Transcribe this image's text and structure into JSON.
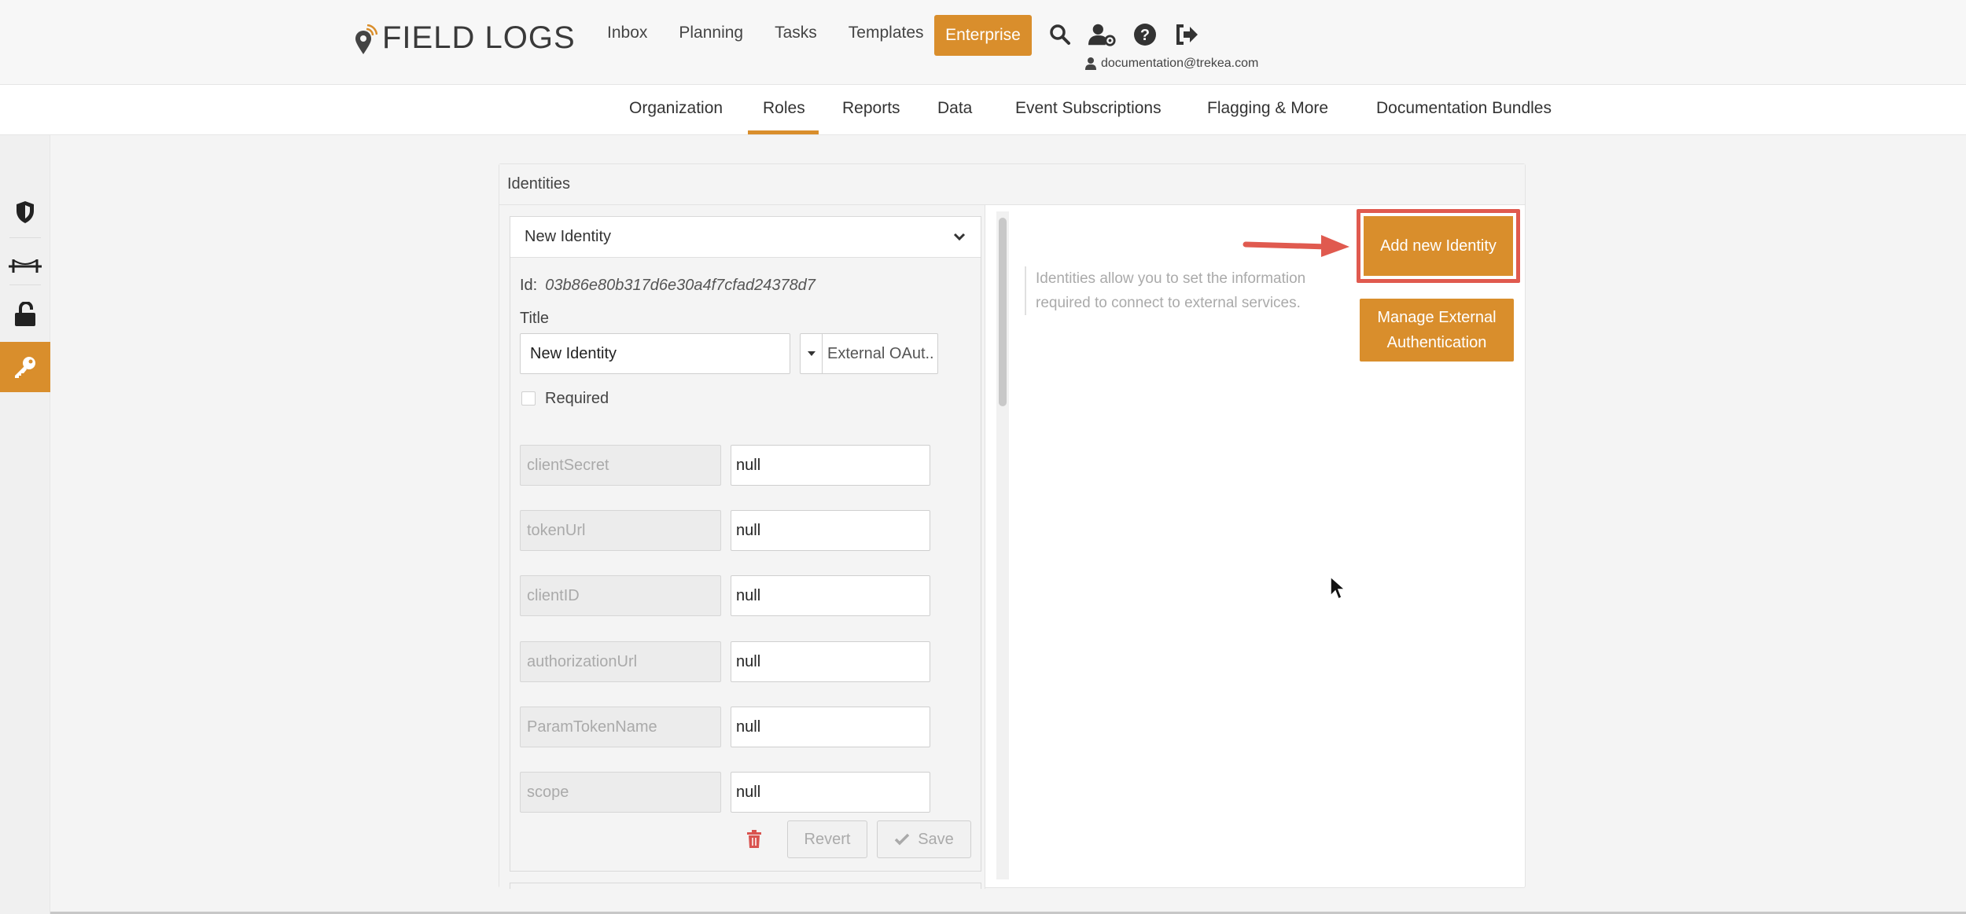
{
  "brand": {
    "name": "FIELD LOGS"
  },
  "topnav": {
    "items": [
      "Inbox",
      "Planning",
      "Tasks",
      "Templates"
    ],
    "enterprise": "Enterprise"
  },
  "user": {
    "email": "documentation@trekea.com"
  },
  "icons": {
    "search": "search-icon",
    "user_settings": "user-gear-icon",
    "help": "question-circle-icon",
    "logout": "sign-out-icon"
  },
  "subnav": {
    "items": [
      "Organization",
      "Roles",
      "Reports",
      "Data",
      "Event Subscriptions",
      "Flagging & More",
      "Documentation Bundles"
    ],
    "active": "Roles"
  },
  "rail": {
    "items": [
      "shield-icon",
      "bridge-icon",
      "unlock-icon",
      "key-icon"
    ],
    "active": "key-icon"
  },
  "panel": {
    "title": "Identities",
    "info": "Identities allow you to set the information required to connect to external services.",
    "add_button": "Add new Identity",
    "manage_button": "Manage External Authentication"
  },
  "identity": {
    "header": "New Identity",
    "id_label": "Id:",
    "id_value": "03b86e80b317d6e30a4f7cfad24378d7",
    "title_label": "Title",
    "title_value": "New Identity",
    "type_value": "External OAut..",
    "required_label": "Required",
    "fields": [
      {
        "key": "clientSecret",
        "value": "null"
      },
      {
        "key": "tokenUrl",
        "value": "null"
      },
      {
        "key": "clientID",
        "value": "null"
      },
      {
        "key": "authorizationUrl",
        "value": "null"
      },
      {
        "key": "ParamTokenName",
        "value": "null"
      },
      {
        "key": "scope",
        "value": "null"
      }
    ],
    "revert_label": "Revert",
    "save_label": "Save"
  },
  "colors": {
    "accent": "#d98e2c",
    "highlight": "#e05a4f",
    "danger": "#d9534f"
  }
}
